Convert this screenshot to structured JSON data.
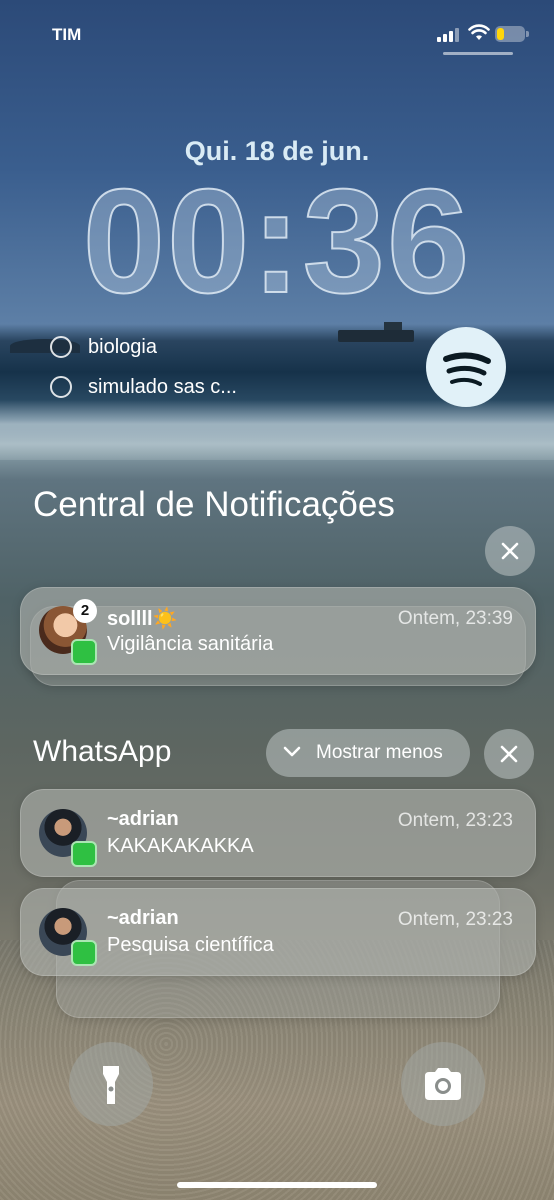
{
  "status_bar": {
    "carrier": "TIM",
    "battery_level": 0.25,
    "battery_color": "#ffd60a"
  },
  "lock": {
    "date": "Qui. 18 de jun.",
    "time": "00:36"
  },
  "widgets": {
    "reminders": [
      {
        "label": "biologia"
      },
      {
        "label": "simulado sas c..."
      }
    ],
    "music_app_icon": "spotify-icon"
  },
  "notification_center": {
    "title": "Central de Notificações",
    "notifications": [
      {
        "sender": "sollll",
        "sender_emoji": "☀️",
        "message": "Vigilância sanitária",
        "timestamp": "Ontem, 23:39",
        "count": "2",
        "app_icon": "whatsapp-icon"
      }
    ]
  },
  "whatsapp_group": {
    "title": "WhatsApp",
    "show_less_label": "Mostrar menos",
    "notifications": [
      {
        "sender": "~adrian",
        "message": "KAKAKAKAKKA",
        "timestamp": "Ontem, 23:23",
        "app_icon": "whatsapp-icon"
      },
      {
        "sender": "~adrian",
        "message": "Pesquisa científica",
        "timestamp": "Ontem, 23:23",
        "app_icon": "whatsapp-icon"
      }
    ]
  },
  "quick_actions": {
    "left": "flashlight-icon",
    "right": "camera-icon"
  },
  "colors": {
    "whatsapp_green": "#2fc042",
    "spotify_bg": "#e1f1f8"
  }
}
